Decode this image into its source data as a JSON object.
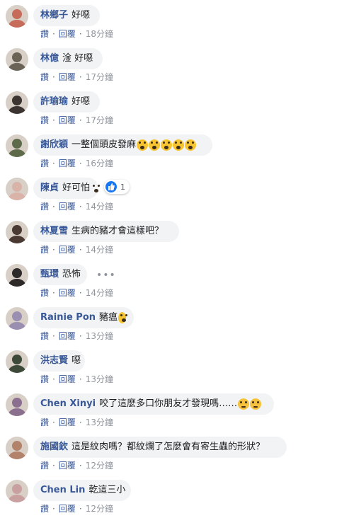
{
  "comments": [
    {
      "name": "林鄉子",
      "text": "好噁",
      "emoji": [],
      "time": "18分鐘",
      "avatar_color": "#c76b5a"
    },
    {
      "name": "林億",
      "text": "淦 好噁",
      "emoji": [],
      "time": "17分鐘",
      "avatar_color": "#6b6355"
    },
    {
      "name": "許瑜瑜",
      "text": "好噁",
      "emoji": [],
      "time": "17分鐘",
      "avatar_color": "#3b3431"
    },
    {
      "name": "謝欣穎",
      "text": "一整個頭皮發麻",
      "emoji": [
        "scream",
        "scream",
        "scream",
        "scream",
        "scream"
      ],
      "time": "16分鐘",
      "avatar_color": "#5d6b4a"
    },
    {
      "name": "陳貞",
      "text": "好可怕",
      "emoji": [
        "scream"
      ],
      "time": "14分鐘",
      "avatar_color": "#d9b3a8"
    },
    {
      "name": "林夏雪",
      "text": "生病的豬才會這樣吧？",
      "emoji": [],
      "time": "14分鐘",
      "avatar_color": "#4a3a33"
    },
    {
      "name": "甄環",
      "text": "恐怖",
      "emoji": [],
      "time": "14分鐘",
      "avatar_color": "#2e2a2a"
    },
    {
      "name": "Rainie Pon",
      "text": "豬瘟",
      "emoji": [
        "scream"
      ],
      "time": "13分鐘",
      "avatar_color": "#9a8fb0"
    },
    {
      "name": "洪志賢",
      "text": "噁",
      "emoji": [],
      "time": "13分鐘",
      "avatar_color": "#3d4a3a"
    },
    {
      "name": "Chen Xinyi",
      "text": "咬了這麼多口你朋友才發現嗎……",
      "emoji": [
        "flushed",
        "flushed"
      ],
      "time": "13分鐘",
      "avatar_color": "#8a6f8f"
    },
    {
      "name": "施國欽",
      "text": "這是紋肉嗎？都紋爛了怎麼會有寄生蟲的形狀？",
      "emoji": [],
      "time": "12分鐘",
      "avatar_color": "#b3826a"
    },
    {
      "name": "Chen Lin",
      "text": "乾這三小",
      "emoji": [],
      "time": "12分鐘",
      "avatar_color": "#c9a0a0"
    }
  ],
  "actions": {
    "like": "讚",
    "reply": "回覆",
    "sep": "·"
  },
  "reaction": {
    "count": "1",
    "icon": "like-icon"
  },
  "colors": {
    "name": "#385898",
    "bubble": "#f2f3f5",
    "time": "#90949c",
    "like_blue": "#1877f2"
  }
}
